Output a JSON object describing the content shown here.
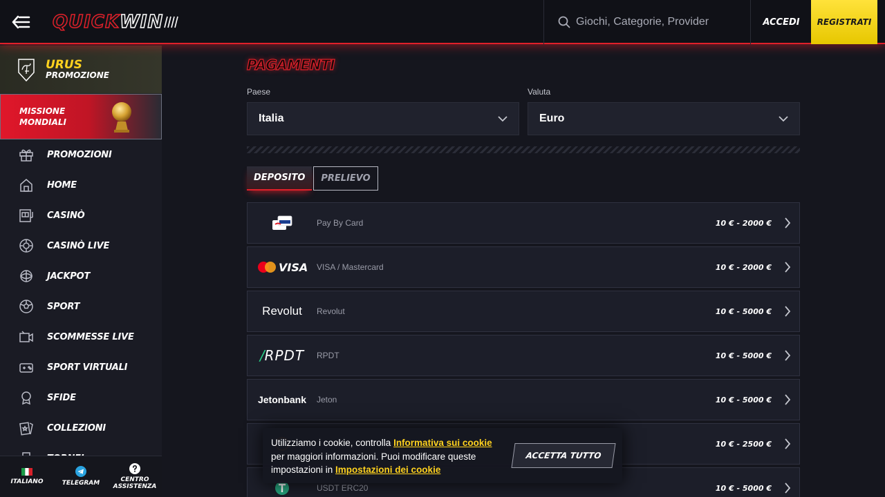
{
  "header": {
    "logo_quick": "QUICK",
    "logo_win": "WIN",
    "search_placeholder": "Giochi, Categorie, Provider",
    "login_label": "ACCEDI",
    "register_label": "REGISTRATI"
  },
  "sidebar": {
    "promo_urus": {
      "title": "URUS",
      "subtitle": "PROMOZIONE"
    },
    "promo_missione": {
      "line1": "MISSIONE",
      "line2": "MONDIALI"
    },
    "items": [
      {
        "label": "PROMOZIONI",
        "icon": "gift-icon"
      },
      {
        "label": "HOME",
        "icon": "home-icon"
      },
      {
        "label": "CASINÒ",
        "icon": "slot-machine-icon"
      },
      {
        "label": "CASINÒ LIVE",
        "icon": "casino-chip-icon"
      },
      {
        "label": "JACKPOT",
        "icon": "jackpot-icon"
      },
      {
        "label": "SPORT",
        "icon": "soccer-ball-icon"
      },
      {
        "label": "SCOMMESSE LIVE",
        "icon": "video-camera-icon"
      },
      {
        "label": "SPORT VIRTUALI",
        "icon": "gamepad-icon"
      },
      {
        "label": "SFIDE",
        "icon": "medal-icon"
      },
      {
        "label": "COLLEZIONI",
        "icon": "cards-icon"
      },
      {
        "label": "TORNEI",
        "icon": "trophy-icon"
      }
    ],
    "bottom": {
      "language": "ITALIANO",
      "telegram": "TELEGRAM",
      "support_line1": "CENTRO",
      "support_line2": "ASSISTENZA"
    }
  },
  "main": {
    "title": "PAGAMENTI",
    "country_label": "Paese",
    "country_value": "Italia",
    "currency_label": "Valuta",
    "currency_value": "Euro",
    "tabs": [
      {
        "label": "DEPOSITO",
        "active": true
      },
      {
        "label": "PRELIEVO",
        "active": false
      }
    ],
    "methods": [
      {
        "name": "Pay By Card",
        "range": "10 € - 2000 €",
        "logo": "card-icon"
      },
      {
        "name": "VISA / Mastercard",
        "range": "10 € - 2000 €",
        "logo": "visa-mastercard-logo"
      },
      {
        "name": "Revolut",
        "range": "10 € - 5000 €",
        "logo": "Revolut"
      },
      {
        "name": "RPDT",
        "range": "10 € - 5000 €",
        "logo": "RPDT"
      },
      {
        "name": "Jeton",
        "range": "10 € - 5000 €",
        "logo": "Jetonbank"
      },
      {
        "name": "",
        "range": "10 € - 2500 €",
        "logo": "crypto-icon"
      },
      {
        "name": "USDT ERC20",
        "range": "10 € - 5000 €",
        "logo": "tether-icon"
      }
    ]
  },
  "cookie": {
    "text1": "Utilizziamo i cookie, controlla ",
    "link1": "Informativa sui cookie",
    "text2": " per maggiori informazioni. Puoi modificare queste impostazioni in ",
    "link2": "Impostazioni dei cookie",
    "accept": "ACCETTA TUTTO"
  },
  "colors": {
    "accent_red": "#e0202a",
    "accent_yellow": "#ffd21e",
    "background": "#15161e",
    "panel": "#1c1e29"
  }
}
